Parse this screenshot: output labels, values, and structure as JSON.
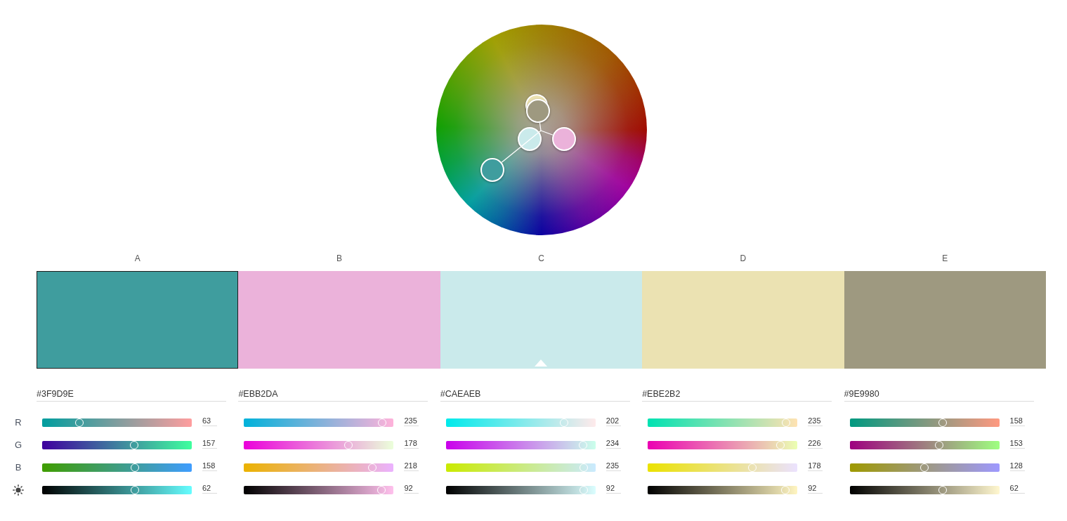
{
  "colors": [
    {
      "label": "A",
      "color": "#3f9d9e",
      "selected": true,
      "base": false,
      "hex": "#3F9D9E",
      "values": [
        {
          "reading": "63",
          "level": 0.247
        },
        {
          "reading": "157",
          "level": 0.616
        },
        {
          "reading": "158",
          "level": 0.62
        },
        {
          "reading": "62",
          "level": 0.62
        }
      ]
    },
    {
      "label": "B",
      "color": "#ebb2da",
      "selected": false,
      "base": false,
      "hex": "#EBB2DA",
      "values": [
        {
          "reading": "235",
          "level": 0.922
        },
        {
          "reading": "178",
          "level": 0.698
        },
        {
          "reading": "218",
          "level": 0.855
        },
        {
          "reading": "92",
          "level": 0.92
        }
      ]
    },
    {
      "label": "C",
      "color": "#caeaeb",
      "selected": false,
      "base": true,
      "hex": "#CAEAEB",
      "values": [
        {
          "reading": "202",
          "level": 0.792
        },
        {
          "reading": "234",
          "level": 0.918
        },
        {
          "reading": "235",
          "level": 0.922
        },
        {
          "reading": "92",
          "level": 0.92
        }
      ]
    },
    {
      "label": "D",
      "color": "#ebe2b2",
      "selected": false,
      "base": false,
      "hex": "#EBE2B2",
      "values": [
        {
          "reading": "235",
          "level": 0.922
        },
        {
          "reading": "226",
          "level": 0.886
        },
        {
          "reading": "178",
          "level": 0.698
        },
        {
          "reading": "92",
          "level": 0.92
        }
      ]
    },
    {
      "label": "E",
      "color": "#9e9980",
      "selected": false,
      "base": false,
      "hex": "#9E9980",
      "values": [
        {
          "reading": "158",
          "level": 0.62
        },
        {
          "reading": "153",
          "level": 0.6
        },
        {
          "reading": "128",
          "level": 0.502
        },
        {
          "reading": "62",
          "level": 0.62
        }
      ]
    }
  ],
  "channels": [
    {
      "kind": "red",
      "label": "R"
    },
    {
      "kind": "green",
      "label": "G"
    },
    {
      "kind": "blue",
      "label": "B"
    },
    {
      "kind": "brightness"
    }
  ]
}
